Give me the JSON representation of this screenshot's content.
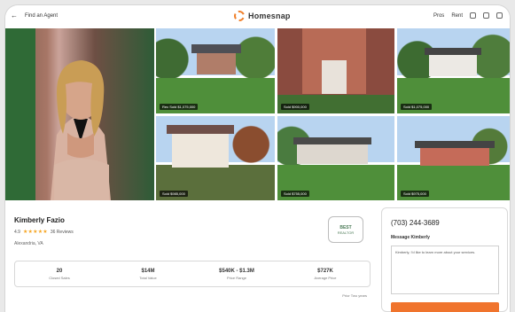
{
  "header": {
    "find_agent": "Find an Agent",
    "brand": "Homesnap",
    "nav_items": [
      "Pros",
      "Rent"
    ]
  },
  "gallery": {
    "photos": [
      {
        "caption": "Rec Sold $1,075,000"
      },
      {
        "caption": "Sold $900,000"
      },
      {
        "caption": "Sold $1,075,000"
      },
      {
        "caption": "Sold $985,000"
      },
      {
        "caption": "Sold $755,000"
      },
      {
        "caption": "Sold $975,000"
      }
    ]
  },
  "agent": {
    "name": "Kimberly Fazio",
    "rating": "4.9",
    "stars": "★★★★★",
    "reviews": "36 Reviews",
    "location": "Alexandria, VA",
    "badge_top": "BEST",
    "badge_bottom": "REALTOR"
  },
  "stats": {
    "items": [
      {
        "value": "20",
        "label": "Closed Sales"
      },
      {
        "value": "$14M",
        "label": "Total Value"
      },
      {
        "value": "$540K - $1.3M",
        "label": "Price Range"
      },
      {
        "value": "$727K",
        "label": "Average Price"
      }
    ],
    "note": "Prior Two years"
  },
  "contact": {
    "phone": "(703) 244-3689",
    "message_title": "Message Kimberly",
    "message_text": "Kimberly, I'd like to learn more about your services."
  },
  "colors": {
    "accent": "#f07f2a",
    "stars": "#f6a623"
  }
}
